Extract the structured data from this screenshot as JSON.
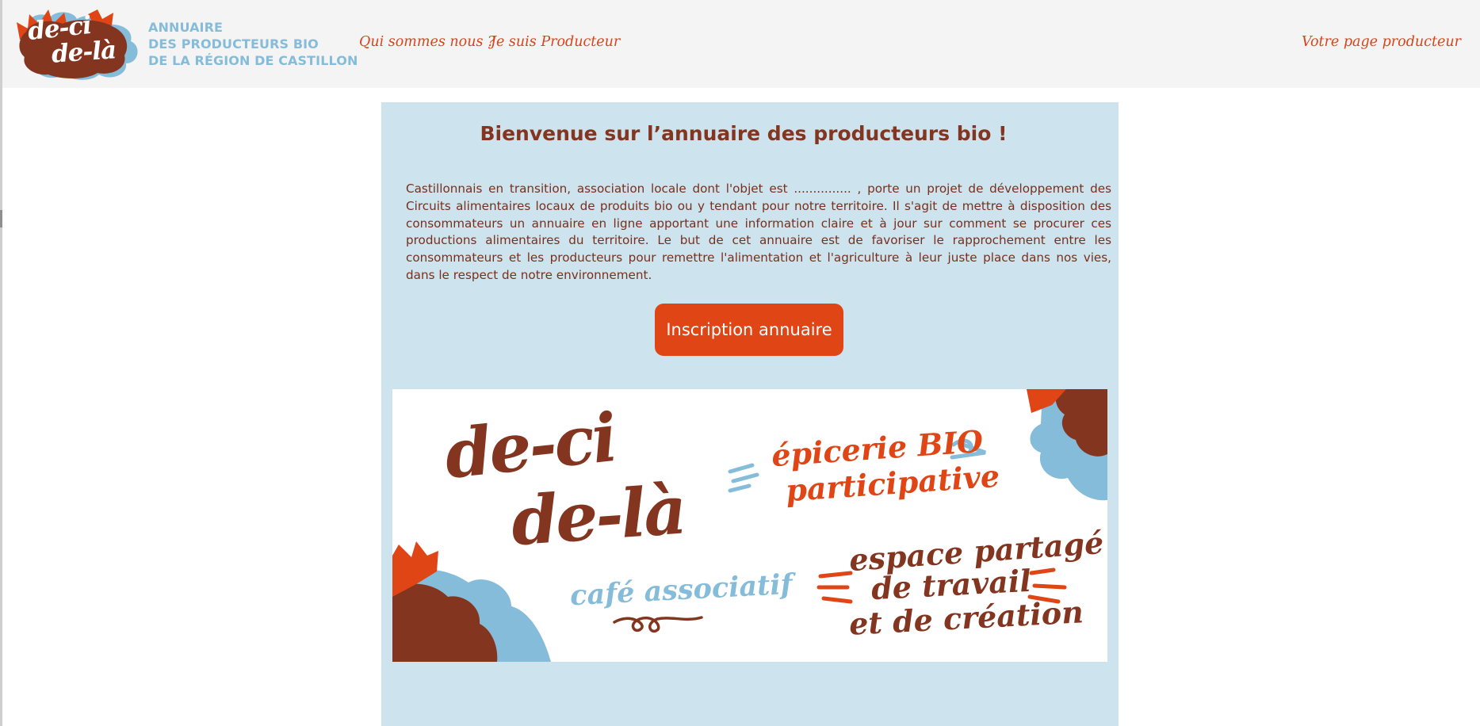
{
  "logo": {
    "line1": "de-ci",
    "line2": "de-là"
  },
  "brand": {
    "line1": "ANNUAIRE",
    "line2": "DES PRODUCTEURS BIO",
    "line3": "DE LA RÉGION DE CASTILLON"
  },
  "nav": {
    "about": "Qui sommes nous ?",
    "producer": "Je suis Producteur",
    "producer_page": "Votre page producteur"
  },
  "main": {
    "title": "Bienvenue sur l’annuaire des producteurs bio !",
    "intro": "Castillonnais en transition, association locale dont l'objet est ............... , porte un projet de développement des Circuits alimentaires locaux de produits bio ou y tendant pour notre territoire. Il s'agit de mettre à disposition des consommateurs un annuaire en ligne apportant une information claire et à jour sur comment se procurer ces productions alimentaires du territoire. Le but de cet annuaire est de favoriser le rapprochement entre les consommateurs et les producteurs pour remettre l'alimentation et l'agriculture à leur juste place dans nos vies, dans le respect de notre environnement.",
    "cta_label": "Inscription annuaire"
  },
  "banner": {
    "logo_line1": "de-ci",
    "logo_line2": "de-là",
    "epicerie_line1": "épicerie BIO",
    "epicerie_line2": "participative",
    "cafe": "café associatif",
    "espace_line1": "espace partagé",
    "espace_line2": "de travail",
    "espace_line3": "et de création"
  },
  "colors": {
    "accent": "#e04516",
    "brown": "#84351f",
    "blue": "#85bcd9",
    "panel": "#cde3ee",
    "header_bg": "#f4f4f4"
  }
}
